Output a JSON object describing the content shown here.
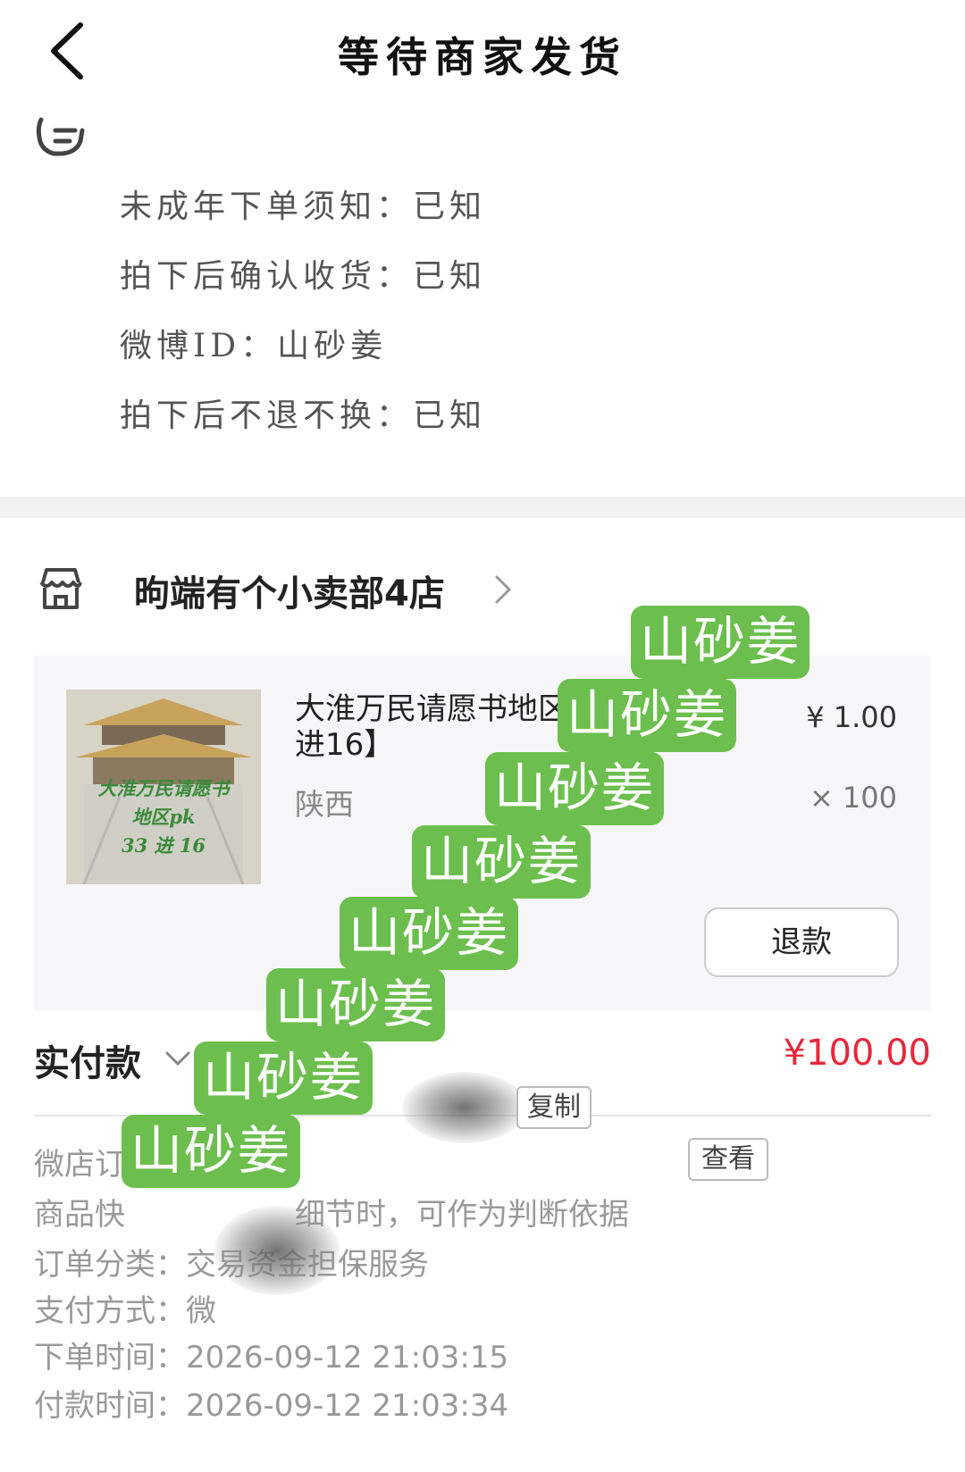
{
  "header": {
    "title": "等待商家发货"
  },
  "notes": {
    "lines": [
      "未成年下单须知：已知",
      "拍下后确认收货：已知",
      "微博ID：山砂姜",
      "拍下后不退不换：已知"
    ]
  },
  "shop": {
    "name": "昫端有个小卖部4店",
    "item": {
      "title": "大淮万民请愿书地区PK",
      "title_line2": "进16】",
      "spec": "陕西",
      "price": "¥ 1.00",
      "quantity": "× 100",
      "thumb_text": [
        "大淮万民请愿书",
        "地区pk",
        "33 进 16"
      ],
      "refund_label": "退款"
    },
    "paid": {
      "label": "实付款",
      "amount": "¥100.00"
    }
  },
  "order_info": {
    "order_no_label": "微店订单号",
    "copy_label": "复制",
    "snapshot_label": "商品快",
    "snapshot_text": "细节时，可作为判断依据",
    "view_label": "查看",
    "category_label": "订单分类：",
    "category_value": "交易资金担保服务",
    "pay_method_label": "支付方式：",
    "pay_method_value": "微",
    "order_time_label": "下单时间：",
    "order_time_value": "2026-09-12 21:03:15",
    "pay_time_label": "付款时间：",
    "pay_time_value": "2026-09-12 21:03:34"
  },
  "watermark": {
    "text": "山砂姜",
    "color": "#6cbf4e"
  }
}
